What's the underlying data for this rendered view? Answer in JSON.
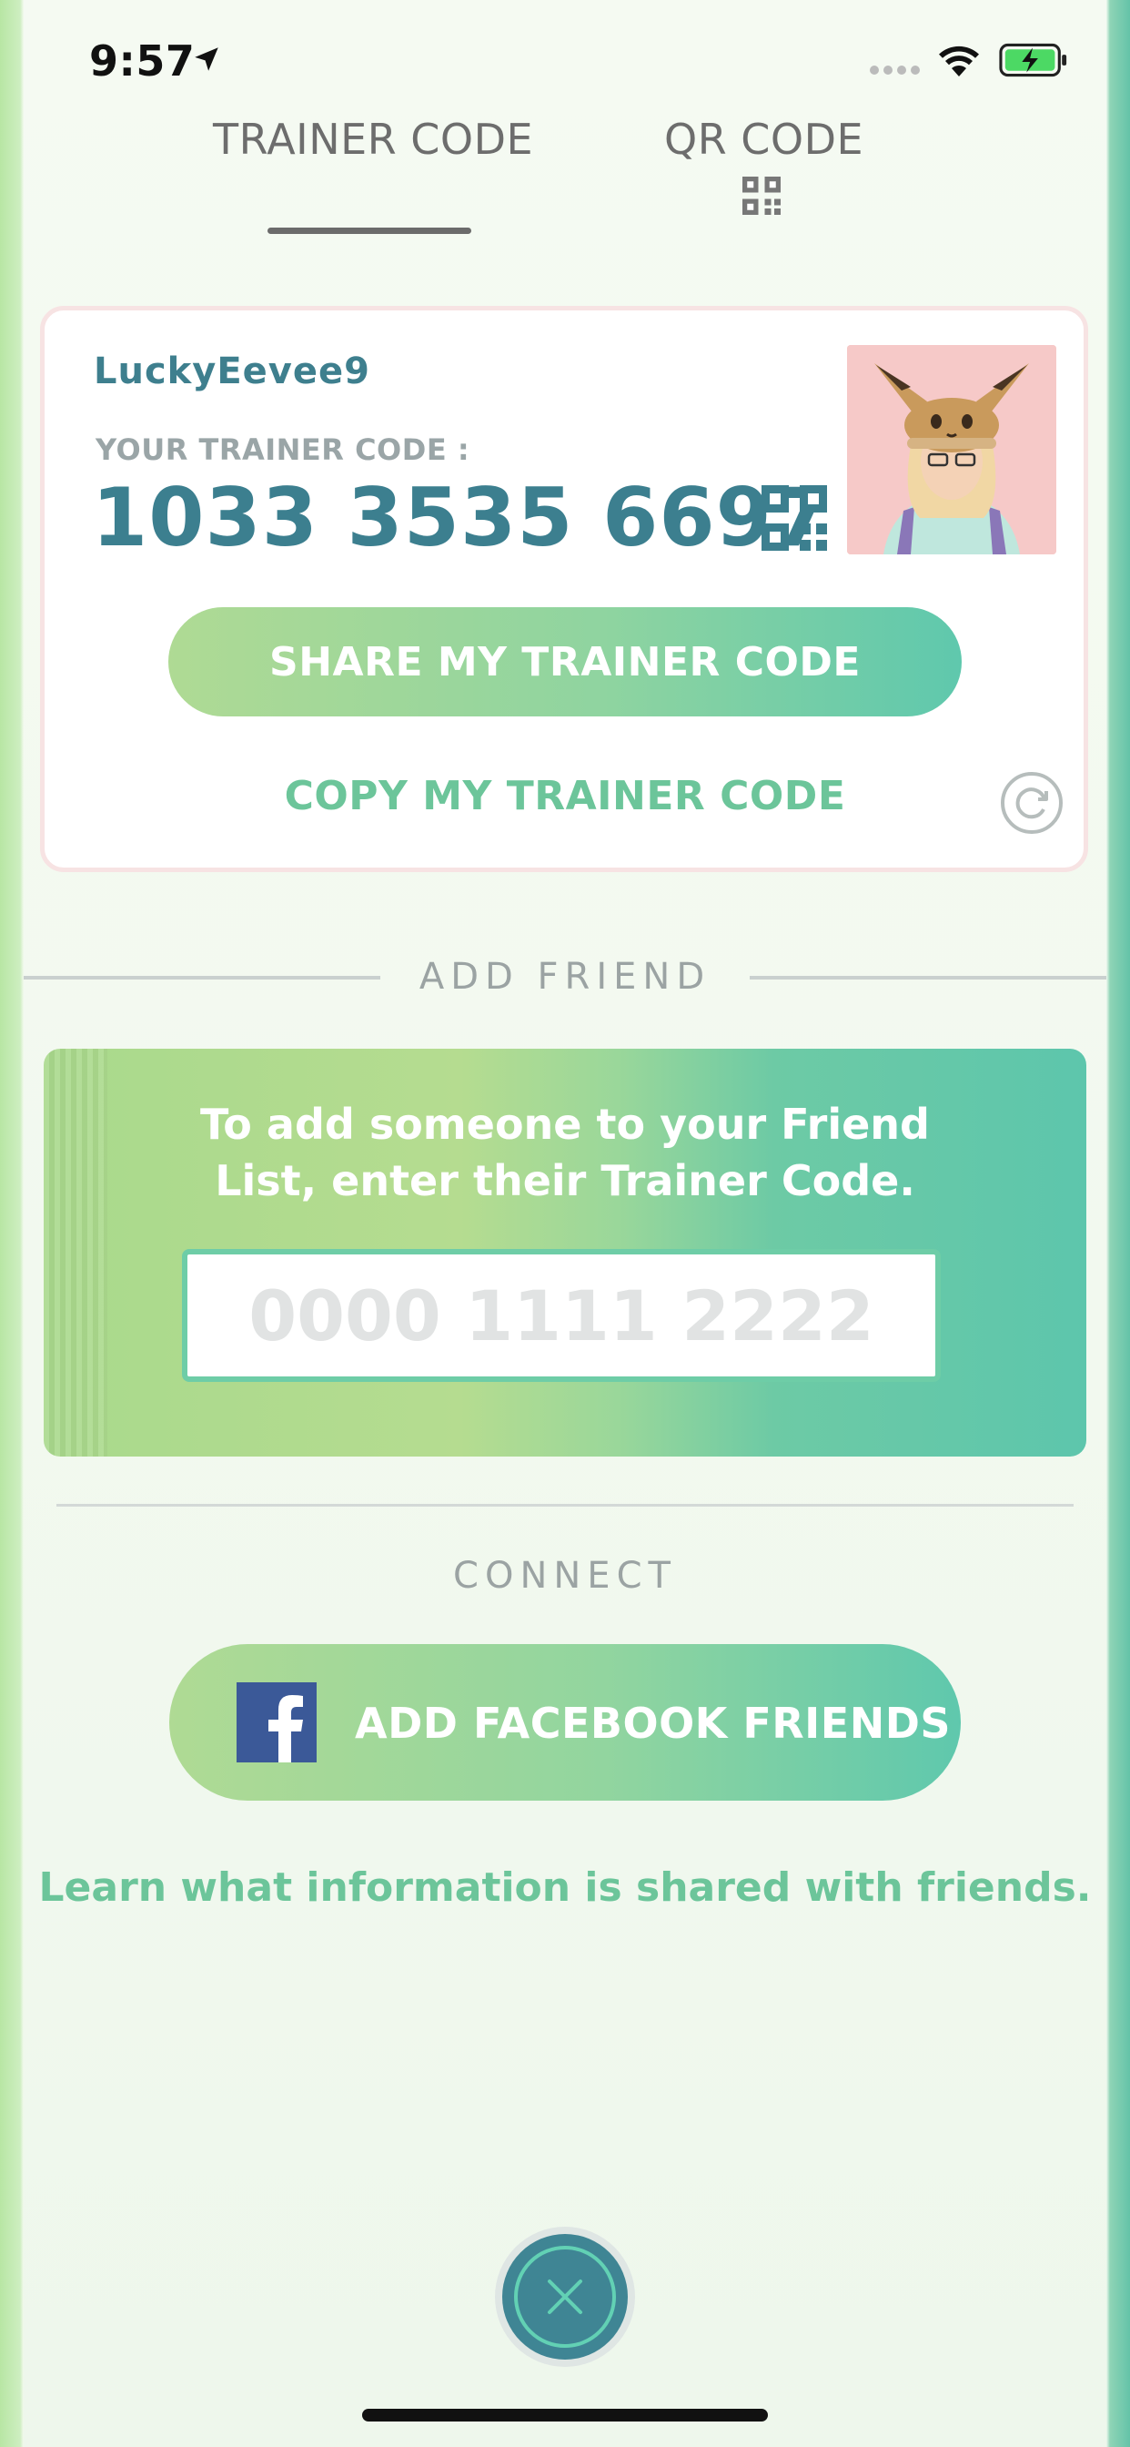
{
  "status_bar": {
    "time": "9:57"
  },
  "tabs": [
    {
      "label": "TRAINER CODE",
      "active": true
    },
    {
      "label": "QR CODE",
      "active": false
    }
  ],
  "trainer_card": {
    "username": "LuckyEevee9",
    "code_label": "YOUR TRAINER CODE :",
    "code_value": "1033 3535 6697",
    "share_label": "SHARE MY TRAINER CODE",
    "copy_label": "COPY MY TRAINER CODE"
  },
  "add_friend": {
    "title": "ADD FRIEND",
    "instructions_line1": "To add someone to your Friend",
    "instructions_line2": "List, enter their Trainer Code.",
    "input_placeholder": "0000 1111 2222",
    "input_value": ""
  },
  "connect": {
    "title": "CONNECT",
    "facebook_label": "ADD FACEBOOK FRIENDS",
    "learn_link": "Learn what information is shared with friends."
  },
  "colors": {
    "accent_teal": "#3c7f8f",
    "accent_green": "#6cc59a",
    "facebook_blue": "#3b5998"
  },
  "icons": [
    "location-arrow-icon",
    "wifi-icon",
    "battery-charging-icon",
    "qr-code-icon",
    "refresh-icon",
    "facebook-icon",
    "close-icon"
  ]
}
